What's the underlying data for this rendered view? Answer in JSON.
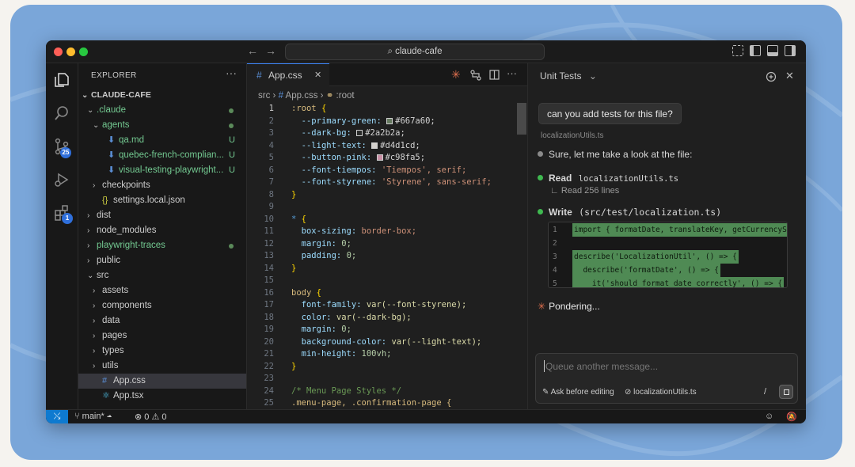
{
  "window": {
    "search": "claude-cafe"
  },
  "activity_bar": {
    "scm_badge": "25",
    "extensions_badge": "1"
  },
  "explorer": {
    "title": "EXPLORER",
    "more": "···",
    "root": "CLAUDE-CAFE",
    "items": [
      {
        "label": ".claude",
        "chev": "⌄",
        "color": "#73c991"
      },
      {
        "label": "agents",
        "chev": "⌄",
        "color": "#73c991"
      },
      {
        "label": "qa.md",
        "chev": "",
        "color": "#73c991",
        "status": "U",
        "icon": "⬇"
      },
      {
        "label": "quebec-french-complian...",
        "chev": "",
        "color": "#73c991",
        "status": "U",
        "icon": "⬇"
      },
      {
        "label": "visual-testing-playwright...",
        "chev": "",
        "color": "#73c991",
        "status": "U",
        "icon": "⬇"
      },
      {
        "label": "checkpoints",
        "chev": "›",
        "color": "#cccccc"
      },
      {
        "label": "settings.local.json",
        "chev": "",
        "color": "#cccccc",
        "icon": "{}"
      },
      {
        "label": "dist",
        "chev": "›",
        "color": "#cccccc"
      },
      {
        "label": "node_modules",
        "chev": "›",
        "color": "#cccccc"
      },
      {
        "label": "playwright-traces",
        "chev": "›",
        "color": "#73c991"
      },
      {
        "label": "public",
        "chev": "›",
        "color": "#cccccc"
      },
      {
        "label": "src",
        "chev": "⌄",
        "color": "#cccccc"
      },
      {
        "label": "assets",
        "chev": "›",
        "color": "#cccccc"
      },
      {
        "label": "components",
        "chev": "›",
        "color": "#cccccc"
      },
      {
        "label": "data",
        "chev": "›",
        "color": "#cccccc"
      },
      {
        "label": "pages",
        "chev": "›",
        "color": "#cccccc"
      },
      {
        "label": "types",
        "chev": "›",
        "color": "#cccccc"
      },
      {
        "label": "utils",
        "chev": "›",
        "color": "#cccccc"
      },
      {
        "label": "App.css",
        "chev": "",
        "color": "#cccccc",
        "icon": "#"
      },
      {
        "label": "App.tsx",
        "chev": "",
        "color": "#cccccc",
        "icon": "⚛"
      }
    ]
  },
  "editor": {
    "tab": {
      "icon": "#",
      "label": "App.css",
      "close": "✕"
    },
    "breadcrumb": {
      "a": "src",
      "b": "App.css",
      "c": ":root"
    },
    "lines": [
      "1",
      "2",
      "3",
      "4",
      "5",
      "6",
      "7",
      "8",
      "9",
      "10",
      "11",
      "12",
      "13",
      "14",
      "15",
      "16",
      "17",
      "18",
      "19",
      "20",
      "21",
      "22",
      "23",
      "24",
      "25"
    ],
    "code": {
      "c1": ":root",
      "c2p": "--primary-green:",
      "c2v": "#667a60;",
      "c3p": "--dark-bg:",
      "c3v": "#2a2b2a;",
      "c4p": "--light-text:",
      "c4v": "#d4d1cd;",
      "c5p": "--button-pink:",
      "c5v": "#c98fa5;",
      "c6p": "--font-tiempos:",
      "c6v": "'Tiempos', serif;",
      "c7p": "--font-styrene:",
      "c7v": "'Styrene', sans-serif;",
      "c10": "*",
      "c11p": "box-sizing:",
      "c11v": "border-box;",
      "c12p": "margin:",
      "c12v": "0;",
      "c13p": "padding:",
      "c13v": "0;",
      "c16": "body",
      "c17p": "font-family:",
      "c17v": "var(--font-styrene);",
      "c18p": "color:",
      "c18v": "var(--dark-bg);",
      "c19p": "margin:",
      "c19v": "0;",
      "c20p": "background-color:",
      "c20v": "var(--light-text);",
      "c21p": "min-height:",
      "c21v": "100vh;",
      "c24": "/* Menu Page Styles */",
      "c25": ".menu-page, .confirmation-page {",
      "ob": "{",
      "cb": "}"
    }
  },
  "panel": {
    "title": "Unit Tests",
    "user_message": "can you add tests for this file?",
    "file_ref": "localizationUtils.ts",
    "m1": "Sure, let me take a look at the file:",
    "read_label": "Read",
    "read_file": "localizationUtils.ts",
    "read_result": "Read 256 lines",
    "write_label": "Write",
    "write_file": "(src/test/localization.ts)",
    "diff": [
      {
        "n": "1",
        "code": "import { formatDate, translateKey, getCurrencyS"
      },
      {
        "n": "2",
        "code": ""
      },
      {
        "n": "3",
        "code": "describe('LocalizationUtil', () => {"
      },
      {
        "n": "4",
        "code": "  describe('formatDate', () => {"
      },
      {
        "n": "5",
        "code": "    it('should format date correctly', () => {"
      }
    ],
    "status": "Pondering...",
    "composer_placeholder": "Queue another message...",
    "ask_label": "Ask before editing",
    "context_file": "localizationUtils.ts",
    "slash": "/"
  },
  "statusbar": {
    "branch": "main*",
    "errors": "0",
    "warnings": "0"
  }
}
